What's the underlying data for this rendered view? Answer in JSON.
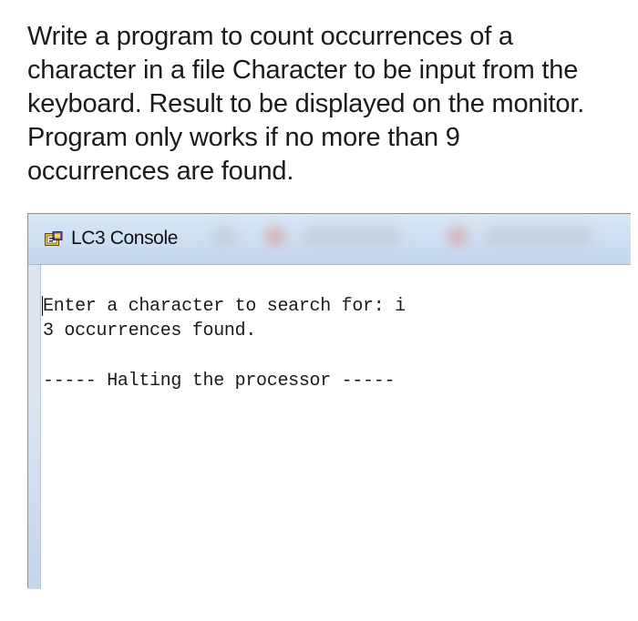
{
  "question": {
    "lines": [
      "Write a program to count occurrences of a",
      "character in a file  Character to be input from the",
      "keyboard. Result to be displayed on the monitor.",
      "Program only works if no more than 9",
      "occurrences are found."
    ]
  },
  "window": {
    "title": "LC3 Console",
    "icon": "lc3-app-icon"
  },
  "console": {
    "lines": [
      "Enter a character to search for: i",
      "3 occurrences found.",
      "",
      "----- Halting the processor -----"
    ]
  },
  "colors": {
    "titlebar": "#cfe0f2",
    "text": "#1b1b1b",
    "console_bg": "#ffffff"
  }
}
